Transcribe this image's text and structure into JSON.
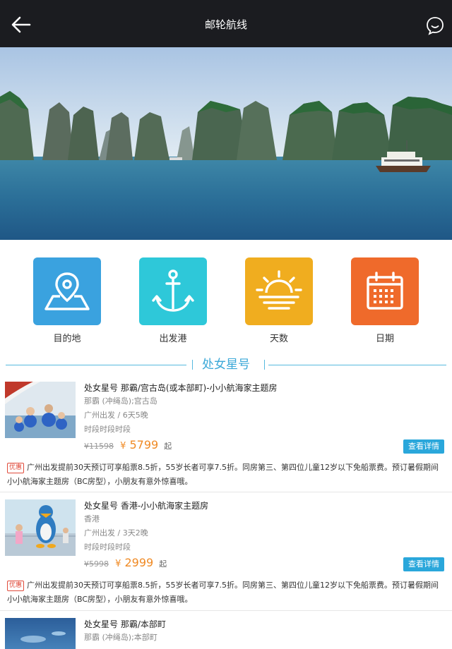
{
  "header": {
    "title": "邮轮航线",
    "back_icon": "arrow-left-icon",
    "chat_icon": "chat-bubble-icon"
  },
  "categories": [
    {
      "label": "目的地",
      "icon": "map-pin-icon",
      "color": "#3aa2df"
    },
    {
      "label": "出发港",
      "icon": "anchor-icon",
      "color": "#2ec8d9"
    },
    {
      "label": "天数",
      "icon": "sunrise-icon",
      "color": "#f0ad1f"
    },
    {
      "label": "日期",
      "icon": "calendar-icon",
      "color": "#ef6a2b"
    }
  ],
  "section": {
    "title": "处女星号"
  },
  "items": [
    {
      "name": "处女星号 那霸/宫古岛(或本部町)-小小航海家主题房",
      "ports": "那霸 (冲绳岛);宫古岛",
      "departure": "广州出发 / 6天5晚",
      "slot": "时段时段时段",
      "old_price": "¥11598",
      "currency": "¥",
      "price": "5799",
      "qi": "起",
      "button": "查看详情",
      "promo_tag": "优惠",
      "promo": "广州出发提前30天预订可享船票8.5折，55岁长者可享7.5折。同房第三、第四位儿童12岁以下免船票费。预订暑假期间小小航海家主题房（BC房型），小朋友有意外惊喜哦。"
    },
    {
      "name": "处女星号 香港-小小航海家主题房",
      "ports": "香港",
      "departure": "广州出发 / 3天2晚",
      "slot": "时段时段时段",
      "old_price": "¥5998",
      "currency": "¥",
      "price": "2999",
      "qi": "起",
      "button": "查看详情",
      "promo_tag": "优惠",
      "promo": "广州出发提前30天预订可享船票8.5折，55岁长者可享7.5折。同房第三、第四位儿童12岁以下免船票费。预订暑假期间小小航海家主题房（BC房型），小朋友有意外惊喜哦。"
    },
    {
      "name": "处女星号 那霸/本部町",
      "ports": "那霸 (冲绳岛);本部町"
    }
  ]
}
